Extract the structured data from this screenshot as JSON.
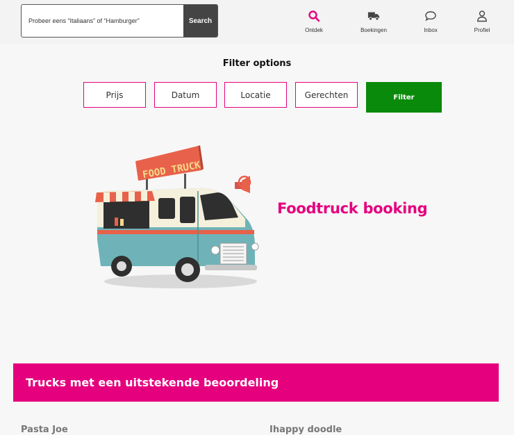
{
  "search": {
    "placeholder": "Probeer eens “Italiaans” of “Hamburger”",
    "button_label": "Search"
  },
  "nav": {
    "items": [
      {
        "label": "Ontdek",
        "icon": "search-icon",
        "active": true
      },
      {
        "label": "Boekingen",
        "icon": "truck-icon"
      },
      {
        "label": "Inbox",
        "icon": "chat-bubble-icon"
      },
      {
        "label": "Profiel",
        "icon": "user-icon"
      }
    ]
  },
  "filters": {
    "title": "Filter options",
    "options": [
      "Prijs",
      "Datum",
      "Locatie",
      "Gerechten"
    ],
    "submit_label": "Filter"
  },
  "hero": {
    "sign_text": "FOOD TRUCK",
    "title": "Foodtruck booking"
  },
  "banner": {
    "title": "Trucks met een uitstekende beoordeling"
  },
  "cards": [
    {
      "title": "Pasta Joe"
    },
    {
      "title": "Ihappy doodle"
    }
  ],
  "colors": {
    "accent": "#e5007e",
    "filter_button": "#0a8a0a",
    "search_button": "#444444",
    "truck_body": "#6fb3b8"
  }
}
